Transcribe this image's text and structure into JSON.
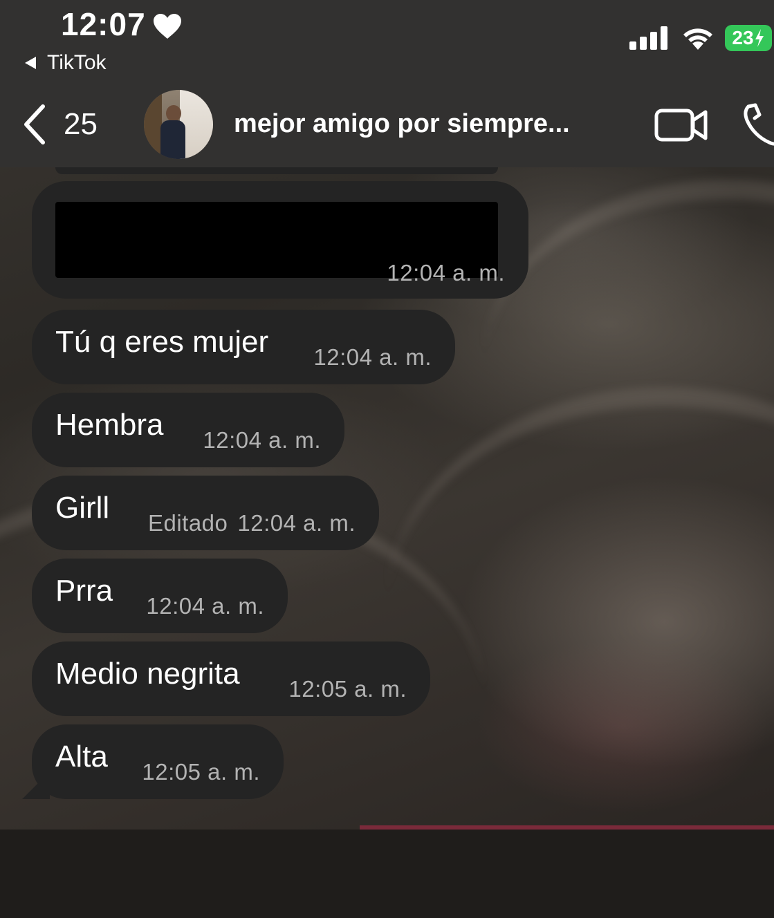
{
  "status_bar": {
    "time": "12:07",
    "back_app": "TikTok",
    "battery": "23",
    "battery_color": "#34c759"
  },
  "header": {
    "back_count": "25",
    "contact_name": "mejor amigo por siempre...",
    "icons": [
      "chevron-left-icon",
      "avatar",
      "video-camera-icon",
      "phone-icon"
    ]
  },
  "messages": [
    {
      "text": "",
      "time": "12:04 a. m.",
      "redacted": true
    },
    {
      "text": "Tú q eres mujer",
      "time": "12:04 a. m."
    },
    {
      "text": "Hembra",
      "time": "12:04 a. m."
    },
    {
      "text": "Girll",
      "edited": "Editado",
      "time": "12:04 a. m."
    },
    {
      "text": "Prra",
      "time": "12:04 a. m."
    },
    {
      "text": "Medio negrita",
      "time": "12:05 a. m."
    },
    {
      "text": "Alta",
      "time": "12:05 a. m."
    }
  ],
  "colors": {
    "bubble": "#242424",
    "header": "#323130",
    "timestamp": "#b3b3b3"
  }
}
